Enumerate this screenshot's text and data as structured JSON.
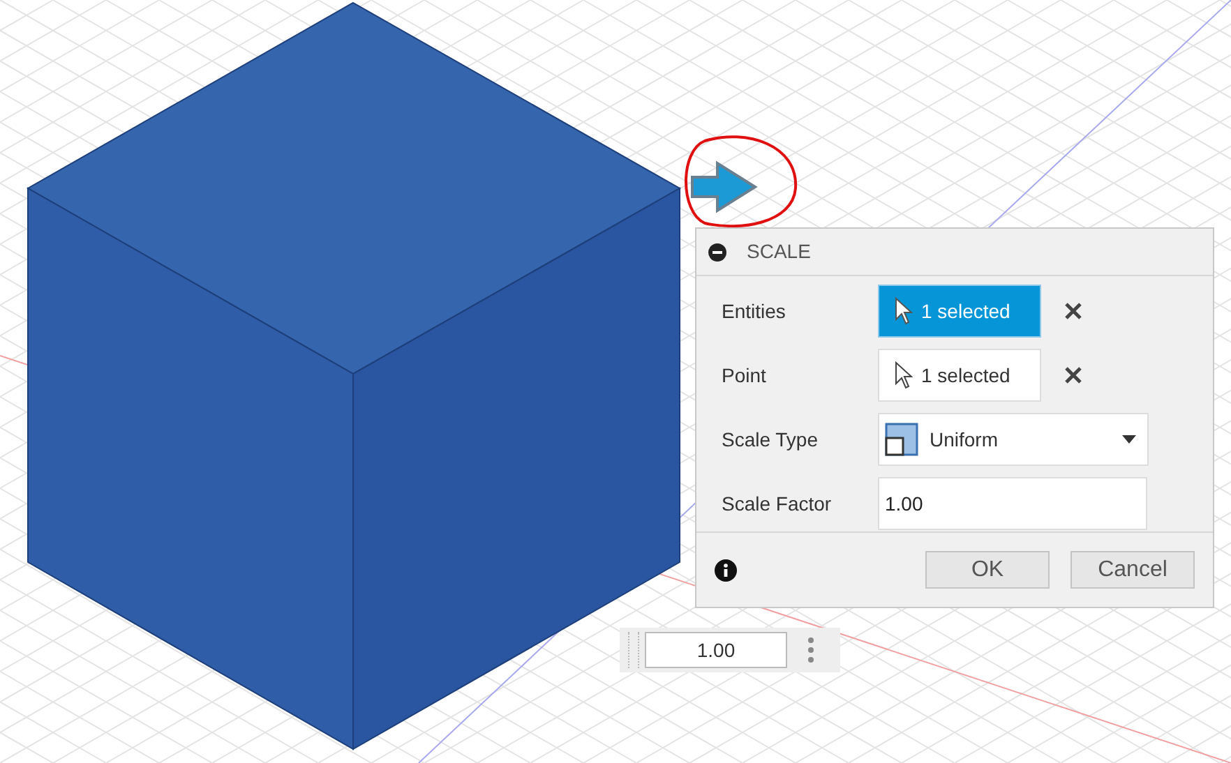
{
  "dialog": {
    "title": "SCALE",
    "rows": [
      {
        "kind": "selection",
        "label": "Entities",
        "value": "1 selected",
        "selected": true
      },
      {
        "kind": "selection",
        "label": "Point",
        "value": "1 selected",
        "selected": false
      },
      {
        "kind": "dropdown",
        "label": "Scale Type",
        "value": "Uniform"
      },
      {
        "kind": "number",
        "label": "Scale Factor",
        "value": "1.00"
      }
    ],
    "buttons": [
      "OK",
      "Cancel"
    ]
  },
  "floating_input": {
    "value": "1.00"
  }
}
